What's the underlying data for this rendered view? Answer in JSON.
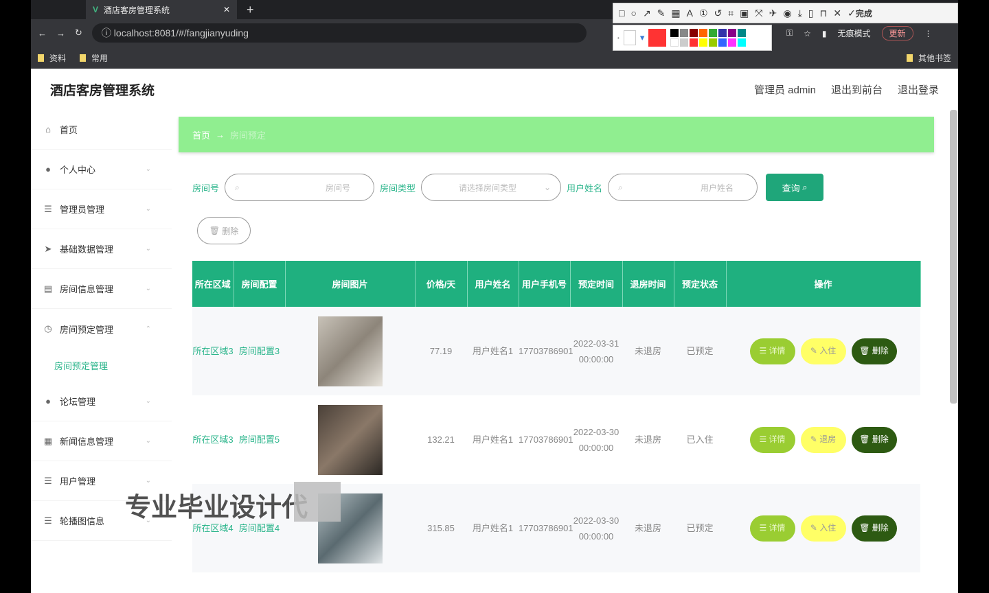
{
  "browser": {
    "tab_title": "酒店客房管理系统",
    "url": "localhost:8081/#/fangjianyuding",
    "bookmarks": [
      "资料",
      "常用"
    ],
    "other_bookmarks": "其他书签",
    "incognito": "无痕模式",
    "update": "更新",
    "done": "完成"
  },
  "header": {
    "title": "酒店客房管理系统",
    "user": "管理员 admin",
    "to_front": "退出到前台",
    "logout": "退出登录"
  },
  "sidebar": {
    "items": [
      {
        "label": "首页",
        "icon": "home-icon"
      },
      {
        "label": "个人中心",
        "icon": "user-icon"
      },
      {
        "label": "管理员管理",
        "icon": "list-icon"
      },
      {
        "label": "基础数据管理",
        "icon": "send-icon"
      },
      {
        "label": "房间信息管理",
        "icon": "doc-icon"
      },
      {
        "label": "房间预定管理",
        "icon": "clock-icon"
      },
      {
        "label": "论坛管理",
        "icon": "user-icon"
      },
      {
        "label": "新闻信息管理",
        "icon": "news-icon"
      },
      {
        "label": "用户管理",
        "icon": "list-icon"
      },
      {
        "label": "轮播图信息",
        "icon": "list-icon"
      }
    ],
    "sub_item": "房间预定管理"
  },
  "breadcrumb": {
    "home": "首页",
    "current": "房间预定"
  },
  "filters": {
    "room_no_label": "房间号",
    "room_no_ph": "房间号",
    "room_type_label": "房间类型",
    "room_type_ph": "请选择房间类型",
    "user_label": "用户姓名",
    "user_ph": "用户姓名",
    "query": "查询",
    "delete": "删除"
  },
  "table": {
    "headers": [
      "所在区域",
      "房间配置",
      "房间图片",
      "价格/天",
      "用户姓名",
      "用户手机号",
      "预定时间",
      "退房时间",
      "预定状态",
      "操作"
    ],
    "rows": [
      {
        "area": "所在区域3",
        "config": "房间配置3",
        "price": "77.19",
        "user": "用户姓名1",
        "phone": "17703786901",
        "time": "2022-03-31 00:00:00",
        "checkout": "未退房",
        "status": "已预定",
        "op2": "入住"
      },
      {
        "area": "所在区域3",
        "config": "房间配置5",
        "price": "132.21",
        "user": "用户姓名1",
        "phone": "17703786901",
        "time": "2022-03-30 00:00:00",
        "checkout": "未退房",
        "status": "已入住",
        "op2": "退房"
      },
      {
        "area": "所在区域4",
        "config": "房间配置4",
        "price": "315.85",
        "user": "用户姓名1",
        "phone": "17703786901",
        "time": "2022-03-30 00:00:00",
        "checkout": "未退房",
        "status": "已预定",
        "op2": "入住"
      }
    ],
    "op_detail": "详情",
    "op_delete": "删除"
  },
  "watermark": "专业毕业设计代"
}
